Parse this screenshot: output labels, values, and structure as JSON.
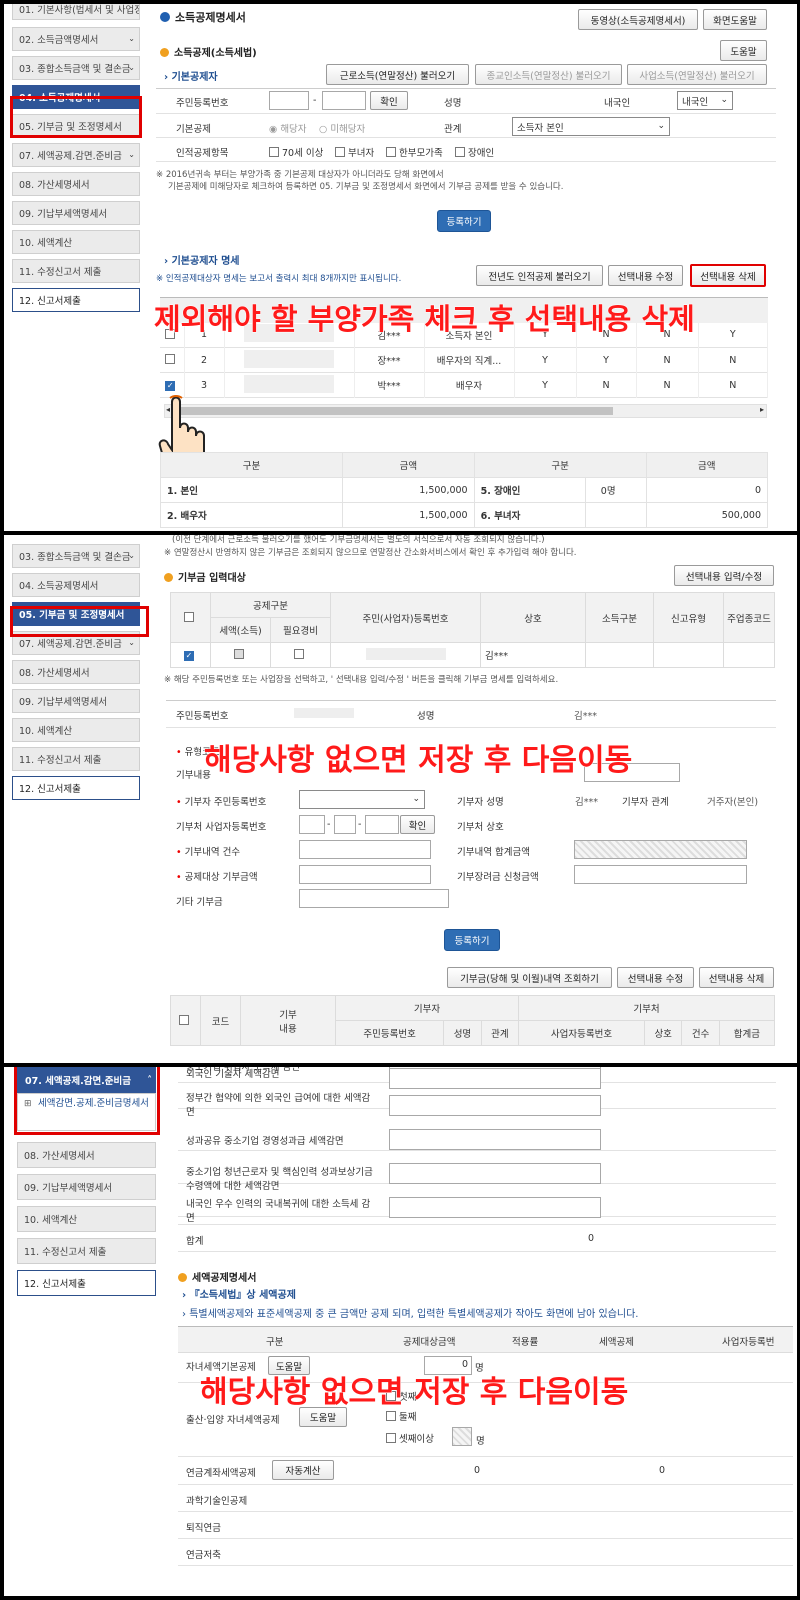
{
  "colors": {
    "accent": "#2f5597",
    "highlight": "#e00000",
    "overlay_text": "#ff1a1a",
    "section_dot": "#f0a020"
  },
  "panel1": {
    "sidebar": [
      {
        "label": "01. 기본사항(법세서 및 사업장정보)",
        "state": "normal"
      },
      {
        "label": "02. 소득금액명세서",
        "state": "normal"
      },
      {
        "label": "03. 종합소득금액 및 결손금",
        "state": "normal"
      },
      {
        "label": "04. 소득공제명세서",
        "state": "selected"
      },
      {
        "label": "05. 기부금 및 조정명세서",
        "state": "normal"
      },
      {
        "label": "07. 세액공제.감면.준비금",
        "state": "normal"
      },
      {
        "label": "08. 가산세명세서",
        "state": "normal"
      },
      {
        "label": "09. 기납부세액명세서",
        "state": "normal"
      },
      {
        "label": "10. 세액계산",
        "state": "normal"
      },
      {
        "label": "11. 수정신고서 제출",
        "state": "normal"
      },
      {
        "label": "12. 신고서제출",
        "state": "white"
      }
    ],
    "page_title": "소득공제명세서",
    "video_btn": "동영상(소득공제명세서)",
    "help_btn": "화면도움말",
    "section_title": "소득공제(소득세법)",
    "section_help": "도움말",
    "sub_basic": "기본공제자",
    "import_btns": [
      "근로소득(연말정산) 불러오기",
      "종교인소득(연말정산) 불러오기",
      "사업소득(연말정산) 불러오기"
    ],
    "form": {
      "rrn_label": "주민등록번호",
      "confirm_btn": "확인",
      "name_label": "성명",
      "nationality_label": "내국인",
      "nationality_value": "내국인",
      "basic_label": "기본공제",
      "radio_yes": "해당자",
      "radio_no": "미해당자",
      "relation_label": "관계",
      "relation_value": "소득자 본인",
      "personal_label": "인적공제항목",
      "personal_opts": [
        "70세 이상",
        "부녀자",
        "한부모가족",
        "장애인"
      ]
    },
    "notes": [
      "※ 2016년귀속 부터는 부양가족 중 기본공제 대상자가 아니더라도 당해 화면에서",
      "기본공제에 미해당자로 체크하여 등록하면 05. 기부금 및 조정명세서 화면에서 기부금 공제를 받을 수 있습니다."
    ],
    "register_btn": "등록하기",
    "sub_list": "기본공제자 명세",
    "list_note": "※ 인적공제대상자 명세는 보고서 출력시 최대 8개까지만 표시됩니다.",
    "list_btns": [
      "전년도 인적공제 불러오기",
      "선택내용 수정",
      "선택내용 삭제"
    ],
    "overlay": "제외해야 할 부양가족 체크 후 선택내용 삭제",
    "rows": [
      {
        "no": "1",
        "name": "김***",
        "rel": "소득자 본인",
        "c1": "Y",
        "c2": "N",
        "c3": "N",
        "c4": "Y"
      },
      {
        "no": "2",
        "name": "장***",
        "rel": "배우자의 직계...",
        "c1": "Y",
        "c2": "Y",
        "c3": "N",
        "c4": "N"
      },
      {
        "no": "3",
        "name": "박***",
        "rel": "배우자",
        "c1": "Y",
        "c2": "N",
        "c3": "N",
        "c4": "N"
      }
    ],
    "summary_headers": [
      "구분",
      "금액",
      "구분",
      "금액"
    ],
    "summary": [
      {
        "a": "1. 본인",
        "b": "1,500,000",
        "c": "5. 장애인",
        "d": "0명",
        "e": "0"
      },
      {
        "a": "2. 배우자",
        "b": "1,500,000",
        "c": "6. 부녀자",
        "d": "",
        "e": "500,000"
      }
    ]
  },
  "panel2": {
    "sidebar": [
      {
        "label": "03. 종합소득금액 및 결손금",
        "state": "normal"
      },
      {
        "label": "04. 소득공제명세서",
        "state": "normal"
      },
      {
        "label": "05. 기부금 및 조정명세서",
        "state": "selected"
      },
      {
        "label": "07. 세액공제.감면.준비금",
        "state": "normal"
      },
      {
        "label": "08. 가산세명세서",
        "state": "normal"
      },
      {
        "label": "09. 기납부세액명세서",
        "state": "normal"
      },
      {
        "label": "10. 세액계산",
        "state": "normal"
      },
      {
        "label": "11. 수정신고서 제출",
        "state": "normal"
      },
      {
        "label": "12. 신고서제출",
        "state": "white"
      }
    ],
    "top_note1": "(이전 단계에서 근로소득 불러오기를 했어도 기부금명세서는 별도의 서식으로서 자동 조회되지 않습니다.)",
    "top_note2": "※ 연말정산시 반영하지 않은 기부금은 조회되지 않으므로 연말정산 간소화서비스에서 확인 후 추가입력 해야 합니다.",
    "section_title": "기부금 입력대상",
    "select_btn": "선택내용 입력/수정",
    "headers": {
      "group": "공제구분",
      "tax": "세액(소득)",
      "exp": "필요경비",
      "rrn": "주민(사업자)등록번호",
      "biz": "상호",
      "income": "소득구분",
      "type": "신고유형",
      "code": "주업종코드"
    },
    "row_name": "김***",
    "note": "※ 해당 주민등록번호 또는 사업장을 선택하고, ' 선택내용 입력/수정 ' 버튼을 클릭해 기부금 명세를 입력하세요.",
    "rrn_label": "주민등록번호",
    "name_label": "성명",
    "name_value": "김***",
    "type_label": "유형코드",
    "content_label": "기부내용",
    "donor_rrn_label": "기부자 주민등록번호",
    "donor_name_label": "기부자 성명",
    "donor_name_value": "김***",
    "donor_rel_label": "기부자 관계",
    "donor_rel_value": "거주자(본인)",
    "org_biz_label": "기부처 사업자등록번호",
    "confirm_btn": "확인",
    "org_name_label": "기부처 상호",
    "count_label": "기부내역 건수",
    "total_label": "기부내역 합계금액",
    "target_label": "공제대상 기부금액",
    "incentive_label": "기부장려금 신청금액",
    "other_label": "기타 기부금",
    "register_btn": "등록하기",
    "bottom_btns": [
      "기부금(당해 및 이월)내역 조회하기",
      "선택내용 수정",
      "선택내용 삭제"
    ],
    "bottom_headers": {
      "code": "코드",
      "content": "기부\n내용",
      "donor": "기부자",
      "org": "기부처",
      "rrn": "주민등록번호",
      "name": "성명",
      "rel": "관계",
      "biz": "사업자등록번호",
      "shop": "상호",
      "count": "건수",
      "sum": "합계금"
    },
    "overlay": "해당사항 없으면 저장 후 다음이동"
  },
  "panel3": {
    "sidebar_sel": "07. 세액공제.감면.준비금",
    "sidebar_child": "세액감면.공제.준비금명세서",
    "sidebar": [
      {
        "label": "08. 가산세명세서",
        "state": "normal"
      },
      {
        "label": "09. 기납부세액명세서",
        "state": "normal"
      },
      {
        "label": "10. 세액계산",
        "state": "normal"
      },
      {
        "label": "11. 수정신고서 제출",
        "state": "normal"
      },
      {
        "label": "12. 신고서제출",
        "state": "white"
      }
    ],
    "rows": [
      "중소기업 취업자 소득세 감면",
      "외국인 기술자 세액감면",
      "정부간 협약에 의한 외국인 급여에 대한 세액감면",
      "성과공유 중소기업 경영성과급 세액감면",
      "중소기업 청년근로자 및 핵심인력 성과보상기금 수령액에 대한 세액감면",
      "내국인 우수 인력의 국내복귀에 대한 소득세 감면"
    ],
    "total_label": "합계",
    "total_value": "0",
    "section_title": "세액공제명세서",
    "sub1": "『소득세법』상 세액공제",
    "sub2": "특별세액공제와 표준세액공제 중 큰 금액만 공제 되며, 입력한 특별세액공제가 작아도 화면에 남아 있습니다.",
    "headers": [
      "구분",
      "공제대상금액",
      "적용률",
      "세액공제",
      "사업자등록번"
    ],
    "child_label": "자녀세액기본공제",
    "help_btn": "도움말",
    "child_count": "0",
    "child_unit": "명",
    "birth_label": "출산·입양 자녀세액공제",
    "birth_opts": [
      "첫째",
      "둘째",
      "셋째이상"
    ],
    "birth_unit": "명",
    "pension_label": "연금계좌세액공제",
    "auto_btn": "자동계산",
    "pension_val1": "0",
    "pension_val2": "0",
    "rows2": [
      "과학기술인공제",
      "퇴직연금",
      "연금저축"
    ],
    "overlay": "해당사항 없으면 저장 후 다음이동"
  }
}
